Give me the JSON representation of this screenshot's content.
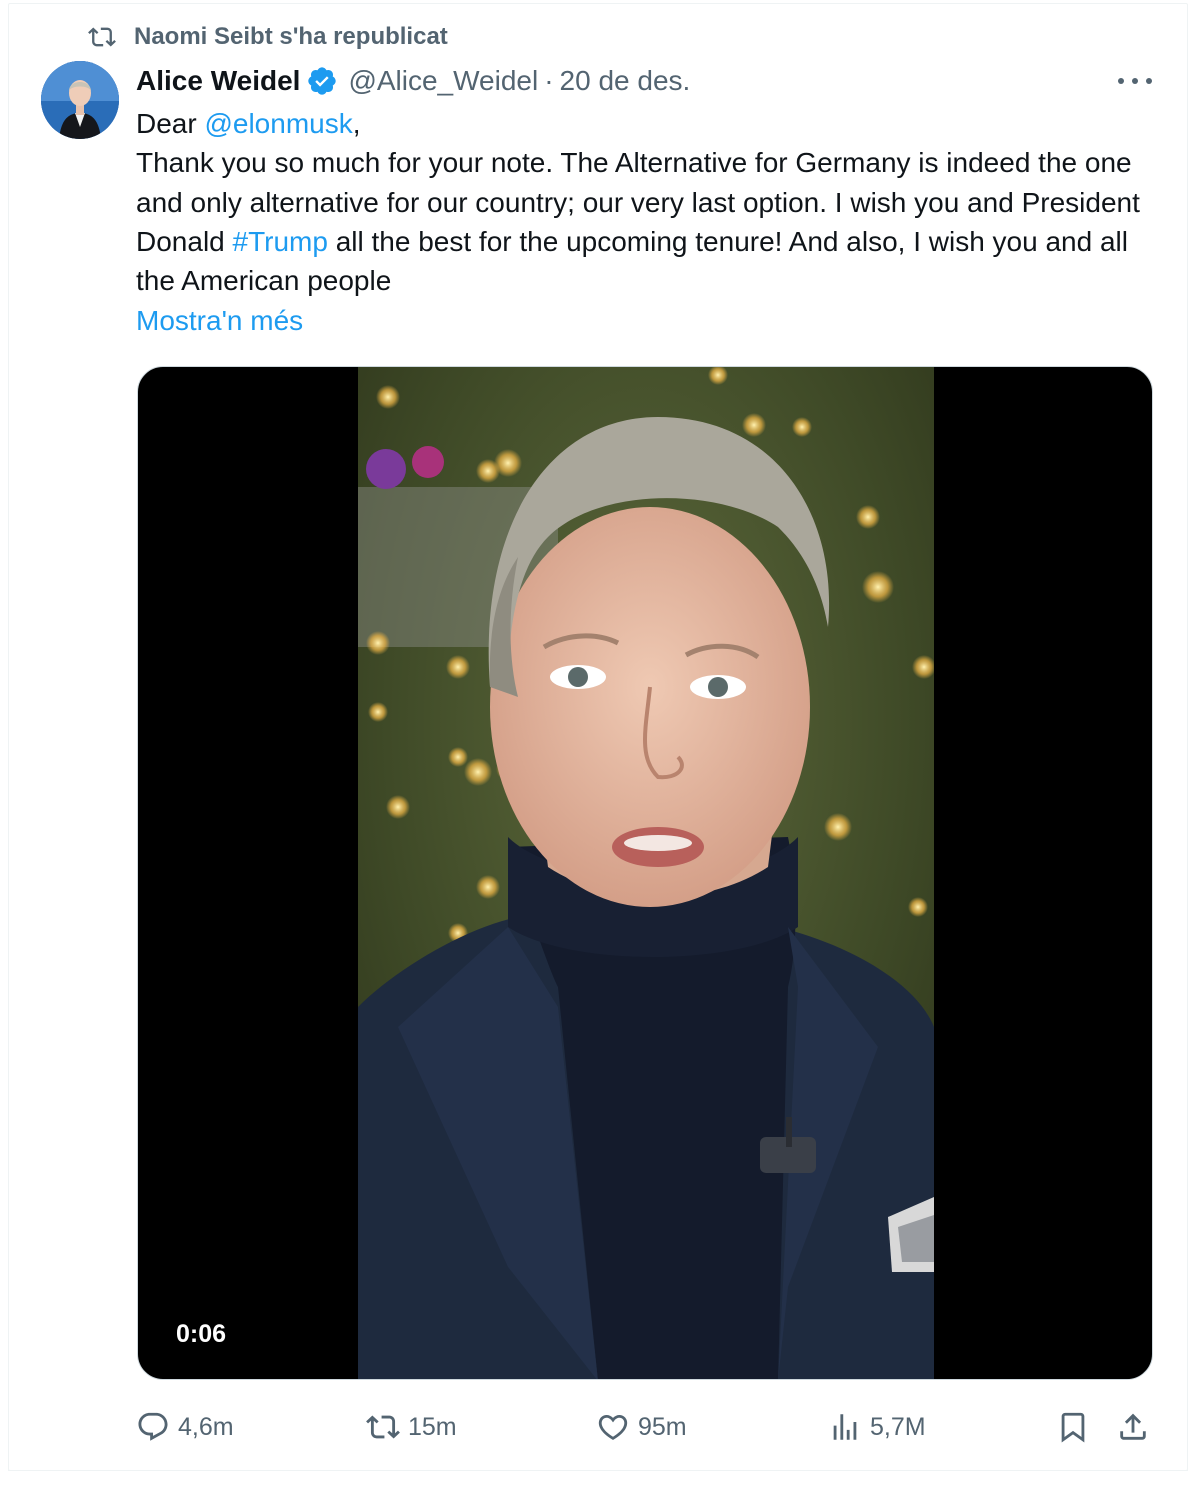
{
  "repost": {
    "label": "Naomi Seibt s'ha republicat",
    "icon": "repost-icon"
  },
  "post": {
    "author_name": "Alice Weidel",
    "verified_icon": "verified-badge-icon",
    "handle": "@Alice_Weidel",
    "separator": "·",
    "date": "20 de des.",
    "more_icon": "more-options-icon",
    "body": {
      "greeting_prefix": "Dear ",
      "mention": "@elonmusk",
      "greeting_suffix": ",",
      "line_part1": "Thank you so much for your note. The Alternative for Germany is indeed the one and only alternative for our country; our very last option. I wish you and President Donald ",
      "hashtag": "#Trump",
      "line_part2": " all the best for the upcoming tenure! And also, I wish you and all the American people"
    },
    "show_more": "Mostra'n més",
    "video": {
      "timestamp": "0:06"
    }
  },
  "actions": {
    "replies": {
      "icon": "reply-icon",
      "count": "4,6m"
    },
    "reposts": {
      "icon": "repost-icon",
      "count": "15m"
    },
    "likes": {
      "icon": "heart-icon",
      "count": "95m"
    },
    "views": {
      "icon": "views-chart-icon",
      "count": "5,7M"
    },
    "bookmark": {
      "icon": "bookmark-icon"
    },
    "share": {
      "icon": "share-icon"
    }
  },
  "colors": {
    "link": "#1d9bf0",
    "secondary_text": "#536471",
    "primary_text": "#0f1419",
    "verified": "#1d9bf0"
  }
}
